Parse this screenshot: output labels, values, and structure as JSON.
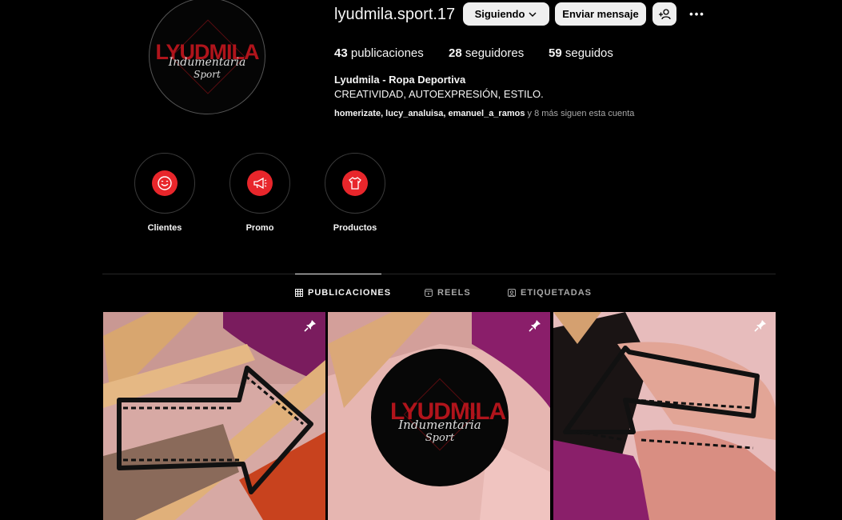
{
  "profile": {
    "username": "lyudmila.sport.17",
    "display_name": "Lyudmila - Ropa Deportiva",
    "bio": "CREATIVIDAD, AUTOEXPRESIÓN, ESTILO.",
    "followed_by_names": "homerizate, lucy_analuisa, emanuel_a_ramos",
    "followed_by_suffix": " y 8 más siguen esta cuenta",
    "avatar_logo": {
      "main": "LYUDMILA",
      "script1": "Indumentaria",
      "script2": "Sport"
    }
  },
  "actions": {
    "following_label": "Siguiendo",
    "message_label": "Enviar mensaje",
    "suggest_icon": "add-person-icon",
    "more_label": "•••"
  },
  "stats": {
    "posts_count": "43",
    "posts_label": "publicaciones",
    "followers_count": "28",
    "followers_label": "seguidores",
    "following_count": "59",
    "following_label": "seguidos"
  },
  "highlights": [
    {
      "label": "Clientes",
      "icon": "smiley-icon"
    },
    {
      "label": "Promo",
      "icon": "megaphone-icon"
    },
    {
      "label": "Productos",
      "icon": "shirt-icon"
    }
  ],
  "tabs": [
    {
      "label": "PUBLICACIONES",
      "icon": "grid-icon",
      "active": true
    },
    {
      "label": "REELS",
      "icon": "reels-icon",
      "active": false
    },
    {
      "label": "ETIQUETADAS",
      "icon": "tagged-icon",
      "active": false
    }
  ],
  "posts": [
    {
      "pinned": true,
      "content": "arrow-right-on-hangers"
    },
    {
      "pinned": true,
      "content": "logo-on-hangers",
      "logo": {
        "main": "LYUDMILA",
        "script1": "Indumentaria",
        "script2": "Sport"
      }
    },
    {
      "pinned": true,
      "content": "arrow-left-hands"
    }
  ],
  "colors": {
    "background": "#000000",
    "accent_red": "#e8262b",
    "logo_red": "#b0141b",
    "button_bg": "#efefef"
  }
}
